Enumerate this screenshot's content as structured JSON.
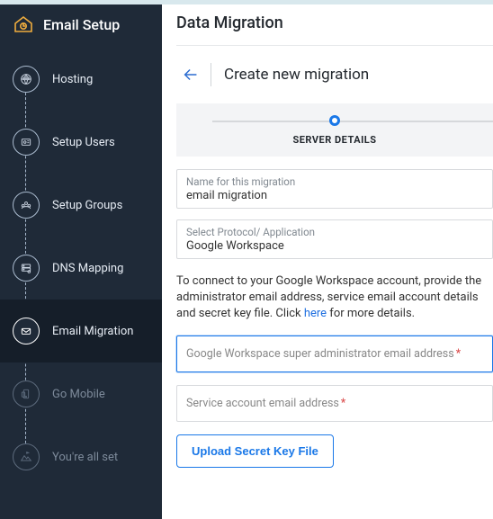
{
  "app": {
    "title": "Email Setup"
  },
  "sidebar": {
    "items": [
      {
        "id": "hosting",
        "label": "Hosting"
      },
      {
        "id": "setup-users",
        "label": "Setup Users"
      },
      {
        "id": "setup-groups",
        "label": "Setup Groups"
      },
      {
        "id": "dns-mapping",
        "label": "DNS Mapping"
      },
      {
        "id": "email-migration",
        "label": "Email Migration",
        "active": true
      },
      {
        "id": "go-mobile",
        "label": "Go Mobile",
        "muted": true
      },
      {
        "id": "all-set",
        "label": "You're all set",
        "muted": true
      }
    ]
  },
  "page": {
    "title": "Data Migration",
    "subtitle": "Create new migration",
    "step_label": "SERVER DETAILS"
  },
  "form": {
    "name_label": "Name for this migration",
    "name_value": "email migration",
    "protocol_label": "Select Protocol/ Application",
    "protocol_value": "Google Workspace",
    "info_prefix": "To connect to your Google Workspace account, provide the administrator email address, service email account details and secret key file. Click ",
    "info_link": "here",
    "info_suffix": " for more details.",
    "admin_email_placeholder": "Google Workspace super administrator email address",
    "service_email_placeholder": "Service account email address",
    "upload_button": "Upload Secret Key File"
  }
}
